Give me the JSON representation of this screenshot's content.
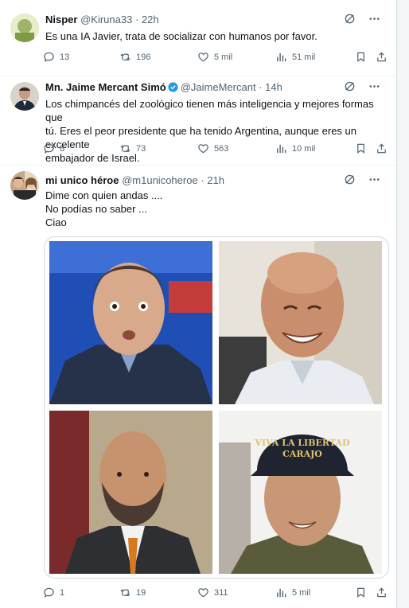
{
  "tweets": [
    {
      "name": "Nisper",
      "handle": "@Kiruna33",
      "time": "· 22h",
      "text_lines": [
        "Es una IA Javier, trata de socializar con humanos por favor."
      ],
      "replies": "13",
      "retweets": "196",
      "likes": "5 mil",
      "views": "51 mil"
    },
    {
      "name": "Mn. Jaime Mercant Simó",
      "handle": "@JaimeMercant",
      "time": "· 14h",
      "verified": true,
      "text_lines": [
        "Los chimpancés del zoológico tienen más inteligencia y mejores formas que",
        "tú. Eres el peor presidente que ha tenido Argentina, aunque eres un excelente",
        "embajador de Israel."
      ],
      "replies": "8",
      "retweets": "73",
      "likes": "563",
      "views": "10 mil"
    },
    {
      "name": "mi unico héroe",
      "handle": "@m1unicoheroe",
      "time": "· 21h",
      "text_lines": [
        "Dime con quien andas ....",
        "No podías no saber ...",
        "Ciao"
      ],
      "cap_text": [
        "VIVA LA LIBERTAD",
        "CARAJO"
      ],
      "replies": "1",
      "retweets": "19",
      "likes": "311",
      "views": "5 mil"
    }
  ],
  "colors": {
    "text": "#0f1419",
    "muted": "#536471",
    "verified": "#1d9bf0",
    "border": "#eff3f4"
  },
  "icons": [
    "grok-icon",
    "more-icon",
    "reply-icon",
    "retweet-icon",
    "like-icon",
    "views-icon",
    "bookmark-icon",
    "share-icon"
  ]
}
